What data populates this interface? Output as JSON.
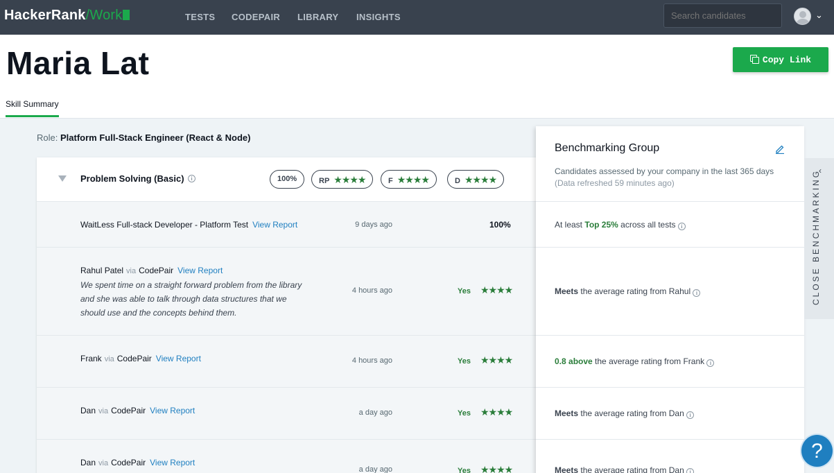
{
  "nav": {
    "brand": "HackerRank",
    "brand_suffix": "/Work",
    "links": [
      "TESTS",
      "CODEPAIR",
      "LIBRARY",
      "INSIGHTS"
    ],
    "search_placeholder": "Search candidates"
  },
  "header": {
    "candidate_name": "Maria Lat",
    "copy_link_label": "Copy Link",
    "tab_label": "Skill Summary"
  },
  "role": {
    "label": "Role:",
    "value": "Platform Full-Stack Engineer (React & Node)"
  },
  "skill": {
    "name": "Problem Solving (Basic)",
    "score": "100%",
    "badges": [
      {
        "label": "RP",
        "stars": 4
      },
      {
        "label": "F",
        "stars": 4
      },
      {
        "label": "D",
        "stars": 4
      }
    ]
  },
  "rows": [
    {
      "title": "WaitLess Full-stack Developer - Platform Test",
      "link": "View Report",
      "when": "9 days ago",
      "result": "100%"
    },
    {
      "person": "Rahul Patel",
      "via": "via",
      "source": "CodePair",
      "link": "View Report",
      "comment": "We spent time on a straight forward problem from the library and she was able to talk through data structures that we should use and the concepts behind them.",
      "when": "4 hours ago",
      "result": "Yes",
      "stars": 4
    },
    {
      "person": "Frank",
      "via": "via",
      "source": "CodePair",
      "link": "View Report",
      "when": "4 hours ago",
      "result": "Yes",
      "stars": 4
    },
    {
      "person": "Dan",
      "via": "via",
      "source": "CodePair",
      "link": "View Report",
      "when": "a day ago",
      "result": "Yes",
      "stars": 4
    },
    {
      "person": "Dan",
      "via": "via",
      "source": "CodePair",
      "link": "View Report",
      "when": "a day ago",
      "result": "Yes",
      "stars": 4
    }
  ],
  "benchmark": {
    "title": "Benchmarking Group",
    "subtitle": "Candidates assessed by your company in the last 365 days",
    "refreshed": "(Data refreshed 59 minutes ago)",
    "rows": [
      {
        "prefix": "At least",
        "highlight": "Top 25%",
        "suffix": "across all tests"
      },
      {
        "highlight": "Meets",
        "suffix": "the average rating from Rahul"
      },
      {
        "highlight": "0.8 above",
        "suffix": "the average rating from Frank"
      },
      {
        "highlight": "Meets",
        "suffix": "the average rating from Dan"
      },
      {
        "highlight": "Meets",
        "suffix": "the average rating from Dan"
      }
    ],
    "close_label": "CLOSE BENCHMARKING"
  },
  "help_label": "?",
  "icons": {
    "star": "★",
    "info": "i",
    "edit": "pencil-icon"
  },
  "colors": {
    "nav_bg": "#39424e",
    "accent_green": "#1ba94c",
    "star_green": "#2a7d3a",
    "link_blue": "#1f7fc0"
  }
}
